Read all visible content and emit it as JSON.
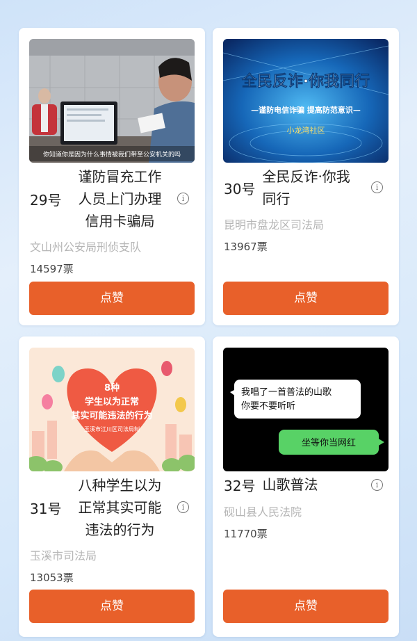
{
  "cards": [
    {
      "number": "29号",
      "title": "谨防冒充工作人员上门办理信用卡骗局",
      "title_lines": [
        "谨防冒充工作",
        "人员上门办理",
        "信用卡骗局"
      ],
      "org": "文山州公安局刑侦支队",
      "votes": "14597票",
      "like_label": "点赞",
      "thumb_caption": "你知道你是因为什么事情被我们带至公安机关的吗"
    },
    {
      "number": "30号",
      "title": "全民反诈·你我同行",
      "title_lines": [
        "全民反诈·你我",
        "同行"
      ],
      "org": "昆明市盘龙区司法局",
      "votes": "13967票",
      "like_label": "点赞",
      "thumb_title": "全民反诈·你我同行",
      "thumb_sub": "—谨防电信诈骗 提高防范意识—",
      "thumb_author": "小龙湾社区"
    },
    {
      "number": "31号",
      "title": "八种学生以为正常其实可能违法的行为",
      "title_lines": [
        "八种学生以为",
        "正常其实可能",
        "违法的行为"
      ],
      "org": "玉溪市司法局",
      "votes": "13053票",
      "like_label": "点赞",
      "thumb_line1": "8种",
      "thumb_line2": "学生以为正常",
      "thumb_line3": "其实可能违法的行为",
      "thumb_credit": "玉溪市江川区司法局制"
    },
    {
      "number": "32号",
      "title": "山歌普法",
      "org": "砚山县人民法院",
      "votes": "11770票",
      "like_label": "点赞",
      "chat_left": [
        "我唱了一首普法的山歌",
        "你要不要听听"
      ],
      "chat_right": "坐等你当网红"
    }
  ],
  "info_glyph": "i",
  "colors": {
    "like_button": "#e8602a",
    "org_text": "#b5b5b5",
    "background": "#d6e8fa"
  }
}
